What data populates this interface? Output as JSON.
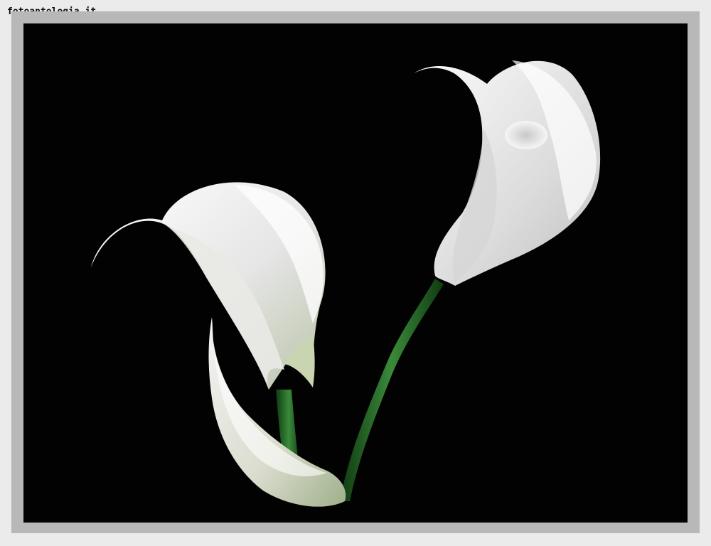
{
  "watermark": {
    "text": "fotoantologia.it"
  },
  "photo": {
    "subject": "calla-lilies",
    "colors": {
      "background": "#020202",
      "frame_outer": "#ebebeb",
      "frame_mat": "#b8b8b8",
      "petal": "#f2f2f2",
      "stem": "#2e7a2e"
    }
  }
}
